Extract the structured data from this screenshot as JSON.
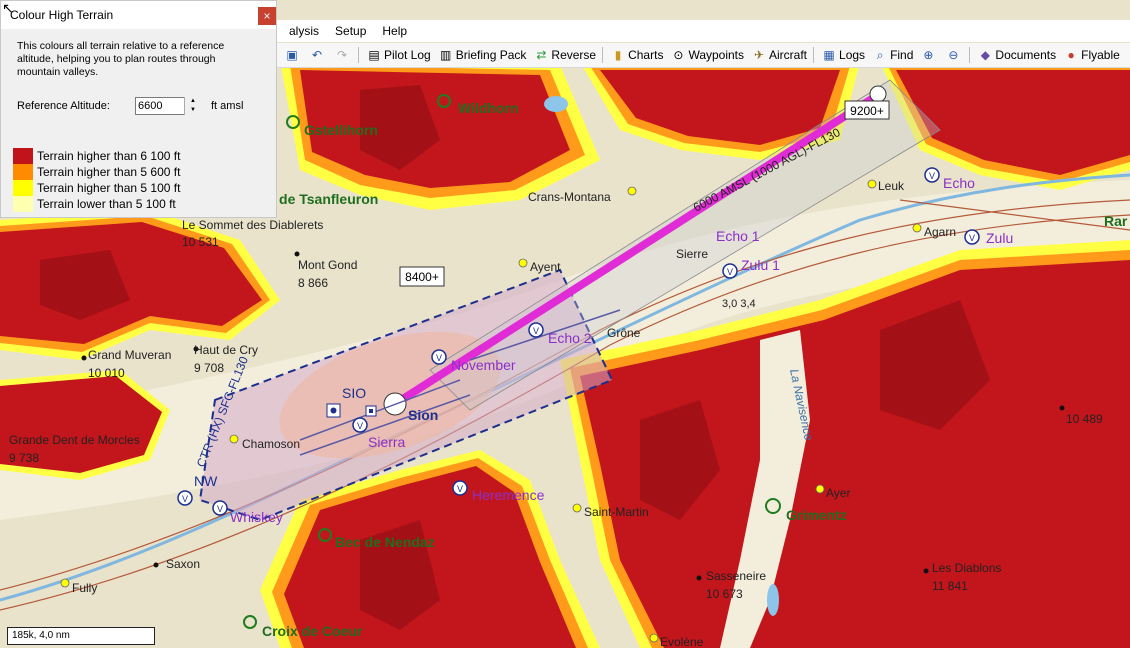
{
  "dialog": {
    "title": "Colour High Terrain",
    "close_label": "×",
    "description": "This colours all terrain relative to a reference altitude, helping you to plan routes through mountain valleys.",
    "reference_label": "Reference Altitude:",
    "reference_value": "6600",
    "reference_unit": "ft amsl",
    "legend": [
      {
        "label": "Terrain higher than 6 100 ft",
        "color": "#c0141a"
      },
      {
        "label": "Terrain higher than 5 600 ft",
        "color": "#ff8c00"
      },
      {
        "label": "Terrain higher than 5 100 ft",
        "color": "#ffff00"
      },
      {
        "label": "Terrain lower than 5 100 ft",
        "color": "#ffffb0"
      }
    ]
  },
  "menu": {
    "items": [
      "alysis",
      "Setup",
      "Help"
    ]
  },
  "toolbar": {
    "pilot_log": "Pilot Log",
    "briefing_pack": "Briefing Pack",
    "reverse": "Reverse",
    "charts": "Charts",
    "waypoints": "Waypoints",
    "aircraft": "Aircraft",
    "logs": "Logs",
    "find": "Find",
    "documents": "Documents",
    "flyable": "Flyable"
  },
  "map": {
    "places": {
      "wildhorn": "Wildhorn",
      "gstellihorn": "Gstellihorn",
      "tsanfleuron": "ier de Tsanfleuron",
      "diablerets": "Le Sommet des Diablerets",
      "diablerets_alt": "10 531",
      "mont_gond": "Mont Gond",
      "mont_gond_alt": "8 866",
      "grand_muveran": "Grand Muveran",
      "grand_muveran_alt": "10 010",
      "haut_de_cry": "Haut de Cry",
      "haut_de_cry_alt": "9 708",
      "dent_morcles": "Grande Dent de Morcles",
      "dent_morcles_alt": "9 738",
      "crans_montana": "Crans-Montana",
      "leuk": "Leuk",
      "agarn": "Agarn",
      "sierre": "Sierre",
      "ayent": "Ayent",
      "grone": "Grône",
      "chamoson": "Chamoson",
      "saint_martin": "Saint-Martin",
      "ayer": "Ayer",
      "saxon": "Saxon",
      "fully": "Fully",
      "sasseneire": "Sasseneire",
      "sasseneire_alt": "10 673",
      "diablons": "Les Diablons",
      "diablons_alt": "11 841",
      "schwarzhorn_alt": "10 489",
      "evolene": "Evolène",
      "la_navisence": "La Navisence",
      "grimentz": "Grimentz",
      "bec_de_nendaz": "Bec de Nendaz",
      "croix_de_coeur": "Croix de Coeur",
      "sion": "Sion",
      "sio": "SIO",
      "rar": "Rar"
    },
    "waypoints": {
      "echo": "Echo",
      "echo1": "Echo 1",
      "echo2": "Echo 2",
      "zulu": "Zulu",
      "zulu1": "Zulu 1",
      "november": "November",
      "sierra": "Sierra",
      "whiskey": "Whiskey",
      "nw": "NW",
      "heremence": "Heremence"
    },
    "altitude_tags": {
      "tag1": "8400+",
      "tag2": "9200+"
    },
    "airspace": {
      "ctr": "CTR (HX) SFC-FL130",
      "corridor": "6000 AMSL (1000 AGL)-FL130",
      "airway_values": "3,0   3,4"
    },
    "scale": "185k, 4,0 nm"
  }
}
